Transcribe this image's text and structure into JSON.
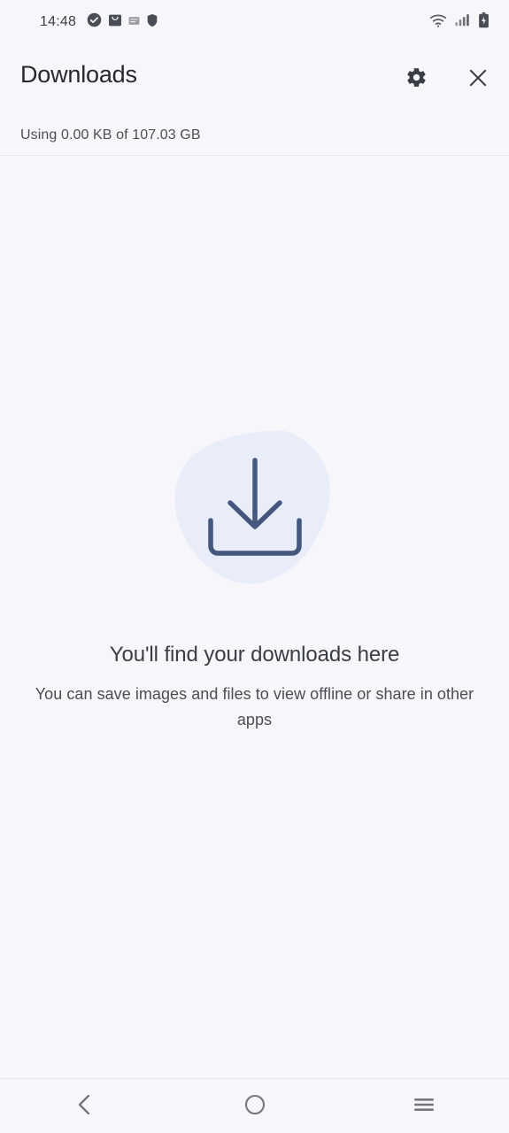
{
  "status_bar": {
    "time": "14:48",
    "left_icons": [
      {
        "name": "check-circle-icon",
        "label": "check-circle"
      },
      {
        "name": "shopping-bag-icon",
        "label": "shopping-bag"
      },
      {
        "name": "app-badge-icon",
        "label": "app-badge"
      },
      {
        "name": "shield-icon",
        "label": "shield"
      }
    ],
    "right_icons": [
      {
        "name": "wifi-icon",
        "label": "wifi"
      },
      {
        "name": "cellular-signal-icon",
        "label": "cellular-signal"
      },
      {
        "name": "battery-charging-icon",
        "label": "battery-charging"
      }
    ]
  },
  "header": {
    "title": "Downloads",
    "settings_label": "Settings",
    "close_label": "Close",
    "storage_text": "Using 0.00 KB of 107.03 GB"
  },
  "empty_state": {
    "illustration_name": "download-arrow-illustration",
    "title": "You'll find your downloads here",
    "subtitle": "You can save images and files to view offline or share in other apps"
  },
  "nav_bar": {
    "back_label": "Back",
    "home_label": "Home",
    "recents_label": "Recents"
  },
  "colors": {
    "background": "#f7f7fb",
    "title_text": "#26282d",
    "secondary_text": "#4a4d55",
    "blob": "#e8edf9",
    "arrow_stroke": "#44577d",
    "icon_dark": "#3c4043",
    "nav_icon": "#74767c",
    "divider": "#e6e6ec"
  }
}
